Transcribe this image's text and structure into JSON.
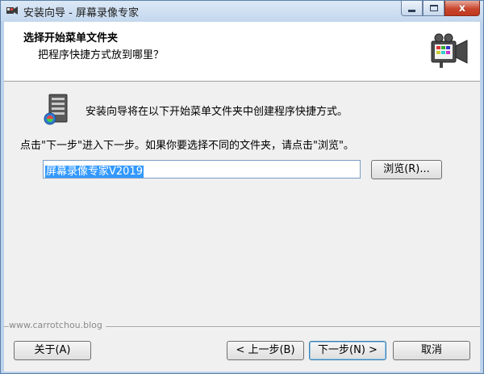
{
  "window": {
    "title": "安装向导 - 屏幕录像专家",
    "close_label": "x"
  },
  "header": {
    "title": "选择开始菜单文件夹",
    "subtitle": "把程序快捷方式放到哪里？"
  },
  "body": {
    "intro_text": "安装向导将在以下开始菜单文件夹中创建程序快捷方式。",
    "instruction_text": "点击\"下一步\"进入下一步。如果你要选择不同的文件夹，请点击\"浏览\"。",
    "folder_value": "屏幕录像专家V2019",
    "browse_label": "浏览(R)..."
  },
  "footer": {
    "watermark": "www.carrotchou.blog",
    "about_label": "关于(A)",
    "back_label": "< 上一步(B)",
    "next_label": "下一步(N) >",
    "cancel_label": "取消"
  },
  "icons": {
    "app": "video-camera-icon",
    "header": "video-camera-icon",
    "body": "start-menu-folder-icon"
  }
}
